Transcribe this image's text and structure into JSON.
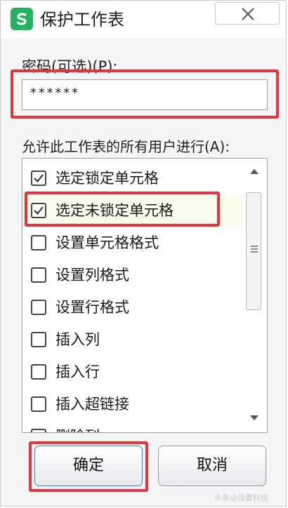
{
  "dialog": {
    "title": "保护工作表",
    "icon": "wps-spreadsheet-icon",
    "close_icon": "close-icon"
  },
  "password": {
    "label": "密码(可选)(P):",
    "value": "******"
  },
  "permissions": {
    "label": "允许此工作表的所有用户进行(A):",
    "items": [
      {
        "label": "选定锁定单元格",
        "checked": true
      },
      {
        "label": "选定未锁定单元格",
        "checked": true
      },
      {
        "label": "设置单元格格式",
        "checked": false
      },
      {
        "label": "设置列格式",
        "checked": false
      },
      {
        "label": "设置行格式",
        "checked": false
      },
      {
        "label": "插入列",
        "checked": false
      },
      {
        "label": "插入行",
        "checked": false
      },
      {
        "label": "插入超链接",
        "checked": false
      },
      {
        "label": "删除列",
        "checked": false
      }
    ]
  },
  "buttons": {
    "ok_label": "确定",
    "cancel_label": "取消"
  },
  "annotation_color": "#e8333a",
  "watermark": "头条@设置科技"
}
